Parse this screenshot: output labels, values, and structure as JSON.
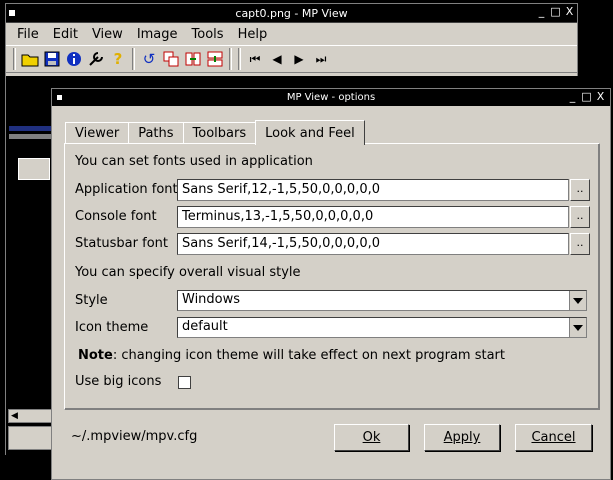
{
  "main_window": {
    "title": "capt0.png - MP View",
    "menu": [
      "File",
      "Edit",
      "View",
      "Image",
      "Tools",
      "Help"
    ],
    "toolbar_icons": [
      "open-folder-icon",
      "save-icon",
      "info-icon",
      "tools-icon",
      "help-icon",
      "rotate-icon",
      "copy-icon",
      "compare-icon",
      "scale-icon",
      "first-icon",
      "prev-icon",
      "next-icon",
      "last-icon"
    ],
    "window_controls": [
      "_",
      "□",
      "X"
    ]
  },
  "dialog": {
    "title": "MP View - options",
    "window_controls": [
      "_",
      "□",
      "X"
    ],
    "tabs": [
      {
        "label": "Viewer",
        "active": false
      },
      {
        "label": "Paths",
        "active": false
      },
      {
        "label": "Toolbars",
        "active": false
      },
      {
        "label": "Look and Feel",
        "active": true
      }
    ],
    "fonts_heading": "You can set fonts used in application",
    "fonts": [
      {
        "label": "Application font",
        "value": "Sans Serif,12,-1,5,50,0,0,0,0,0",
        "button": ".."
      },
      {
        "label": "Console font",
        "value": "Terminus,13,-1,5,50,0,0,0,0,0",
        "button": ".."
      },
      {
        "label": "Statusbar font",
        "value": "Sans Serif,14,-1,5,50,0,0,0,0,0",
        "button": ".."
      }
    ],
    "style_heading": "You can specify overall visual style",
    "style_label": "Style",
    "style_value": "Windows",
    "icon_theme_label": "Icon theme",
    "icon_theme_value": "default",
    "note_bold": "Note",
    "note_text": ": changing icon theme will take effect on next program start",
    "big_icons_label": "Use big icons",
    "big_icons_checked": false,
    "config_path": "~/.mpview/mpv.cfg",
    "ok_label": "Ok",
    "apply_label": "Apply",
    "cancel_label": "Cancel"
  }
}
